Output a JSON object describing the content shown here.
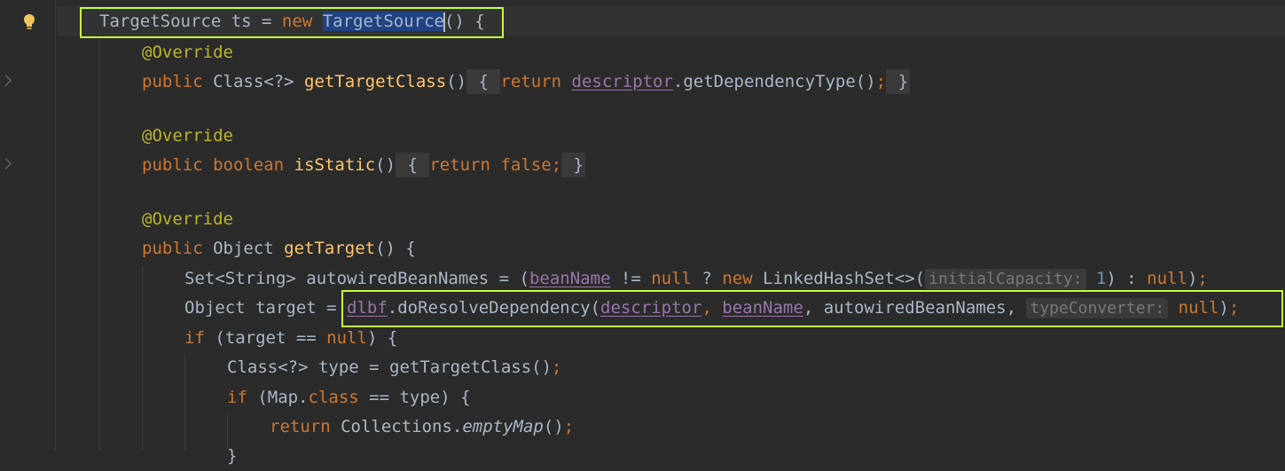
{
  "colors": {
    "background": "#2b2b2b",
    "keyword": "#cc7832",
    "annotation": "#bbb529",
    "method": "#ffc66d",
    "field": "#9876aa",
    "number": "#6897bb",
    "highlight_box": "#c6ff3c"
  },
  "gutter": {
    "intention_icon": "lightbulb-icon"
  },
  "code": {
    "l1": {
      "type": "TargetSource",
      "rest": " ts = ",
      "kw_new": "new",
      "sp": " ",
      "ctor": "TargetSource",
      "end": "() {"
    },
    "l2": {
      "ann": "@Override"
    },
    "l3": {
      "kw": "public",
      "type": " Class<?> ",
      "fn": "getTargetClass",
      "p": "()",
      "ob": " { ",
      "ret": "return",
      "sp": " ",
      "fld": "descriptor",
      "call": ".getDependencyType()",
      "semi": ";",
      "cb": " }"
    },
    "l4": {
      "ann": "@Override"
    },
    "l5": {
      "kw": "public",
      "sp": " ",
      "kw2": "boolean",
      "sp2": " ",
      "fn": "isStatic",
      "p": "()",
      "ob": " { ",
      "ret": "return",
      "sp3": " ",
      "val": "false",
      "semi": ";",
      "cb": " }"
    },
    "l6": {
      "ann": "@Override"
    },
    "l7": {
      "kw": "public",
      "type": " Object ",
      "fn": "getTarget",
      "rest": "() {"
    },
    "l8": {
      "a": "Set<String> autowiredBeanNames = (",
      "fld": "beanName",
      "b": " != ",
      "null1": "null",
      "c": " ? ",
      "kw_new": "new",
      "d": " LinkedHashSet<>(",
      "hint": "initialCapacity:",
      "sp": " ",
      "num": "1",
      "e": ") : ",
      "null2": "null",
      "f": ")",
      "semi": ";"
    },
    "l9": {
      "a": "Object target = ",
      "fld1": "dlbf",
      "b": ".doResolveDependency(",
      "fld2": "descriptor",
      "c": ", ",
      "fld3": "beanName",
      "d": ", autowiredBeanNames, ",
      "hint": "typeConverter:",
      "sp": " ",
      "null": "null",
      "e": ")",
      "semi": ";"
    },
    "l10": {
      "kw": "if",
      "a": " (target == ",
      "null": "null",
      "b": ") {"
    },
    "l11": {
      "a": "Class<?> type = getTargetClass()",
      "semi": ";"
    },
    "l12": {
      "kw": "if",
      "a": " (Map.",
      "kw2": "class",
      "b": " == type) {"
    },
    "l13": {
      "kw": "return",
      "a": " Collections.",
      "it": "emptyMap",
      "b": "()",
      "semi": ";"
    },
    "l14": {
      "a": "}"
    }
  }
}
